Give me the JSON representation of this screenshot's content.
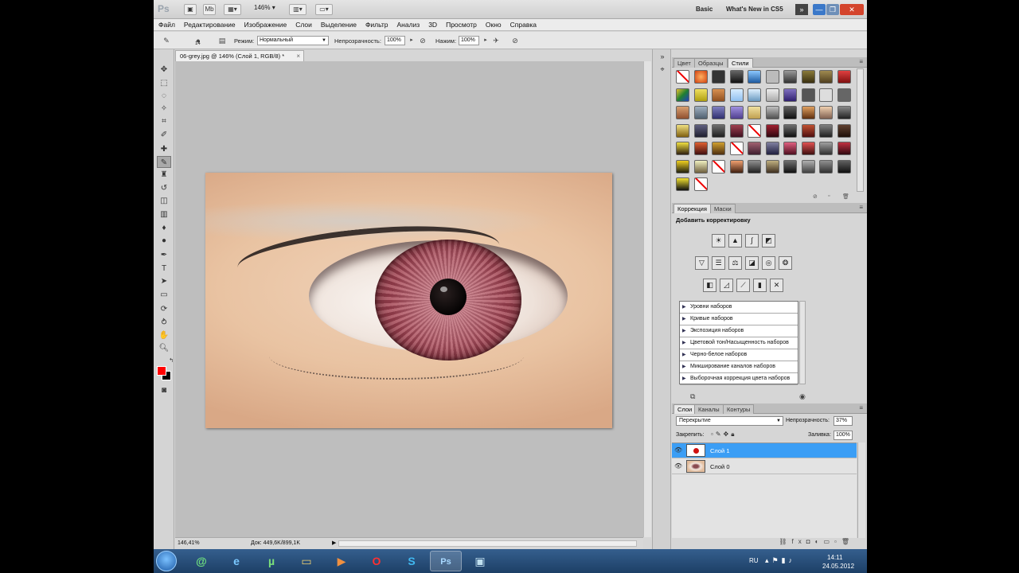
{
  "app": {
    "logo": "Ps"
  },
  "titlebar": {
    "zoom": "146%",
    "workspace_basic": "Basic",
    "workspace_new": "What's New in CS5",
    "more": "»"
  },
  "menu": [
    "Файл",
    "Редактирование",
    "Изображение",
    "Слои",
    "Выделение",
    "Фильтр",
    "Анализ",
    "3D",
    "Просмотр",
    "Окно",
    "Справка"
  ],
  "options": {
    "brush_size": "14",
    "mode_label": "Режим:",
    "mode_value": "Нормальный",
    "opacity_label": "Непрозрачность:",
    "opacity_value": "100%",
    "pressure_label": "Нажим:",
    "pressure_value": "100%"
  },
  "document": {
    "tab_title": "06-grey.jpg @ 146% (Слой 1, RGB/8) *",
    "close": "×"
  },
  "status": {
    "zoom": "146,41%",
    "doc_info": "Док: 449,6K/899,1K"
  },
  "panels": {
    "styles_tabs": [
      "Цвет",
      "Образцы",
      "Стили"
    ],
    "adjust_tabs": [
      "Коррекция",
      "Маски"
    ],
    "adjust_title": "Добавить корректировку",
    "presets": [
      "Уровни наборов",
      "Кривые наборов",
      "Экспозиция наборов",
      "Цветовой тон/Насыщенность наборов",
      "Черно-белое наборов",
      "Микширование каналов наборов",
      "Выборочная коррекция цвета наборов"
    ],
    "layers_tabs": [
      "Слои",
      "Каналы",
      "Контуры"
    ],
    "blend_mode": "Перекрытие",
    "opacity_label": "Непрозрачность:",
    "opacity_value": "37%",
    "lock_label": "Закрепить:",
    "fill_label": "Заливка:",
    "fill_value": "100%",
    "layers": [
      {
        "name": "Слой 1",
        "selected": true
      },
      {
        "name": "Слой 0",
        "selected": false
      }
    ]
  },
  "taskbar": {
    "lang": "RU",
    "time": "14:11",
    "date": "24.05.2012"
  },
  "colors": {
    "foreground": "#ff0000",
    "background": "#000000",
    "selection": "#3b9ef5"
  }
}
